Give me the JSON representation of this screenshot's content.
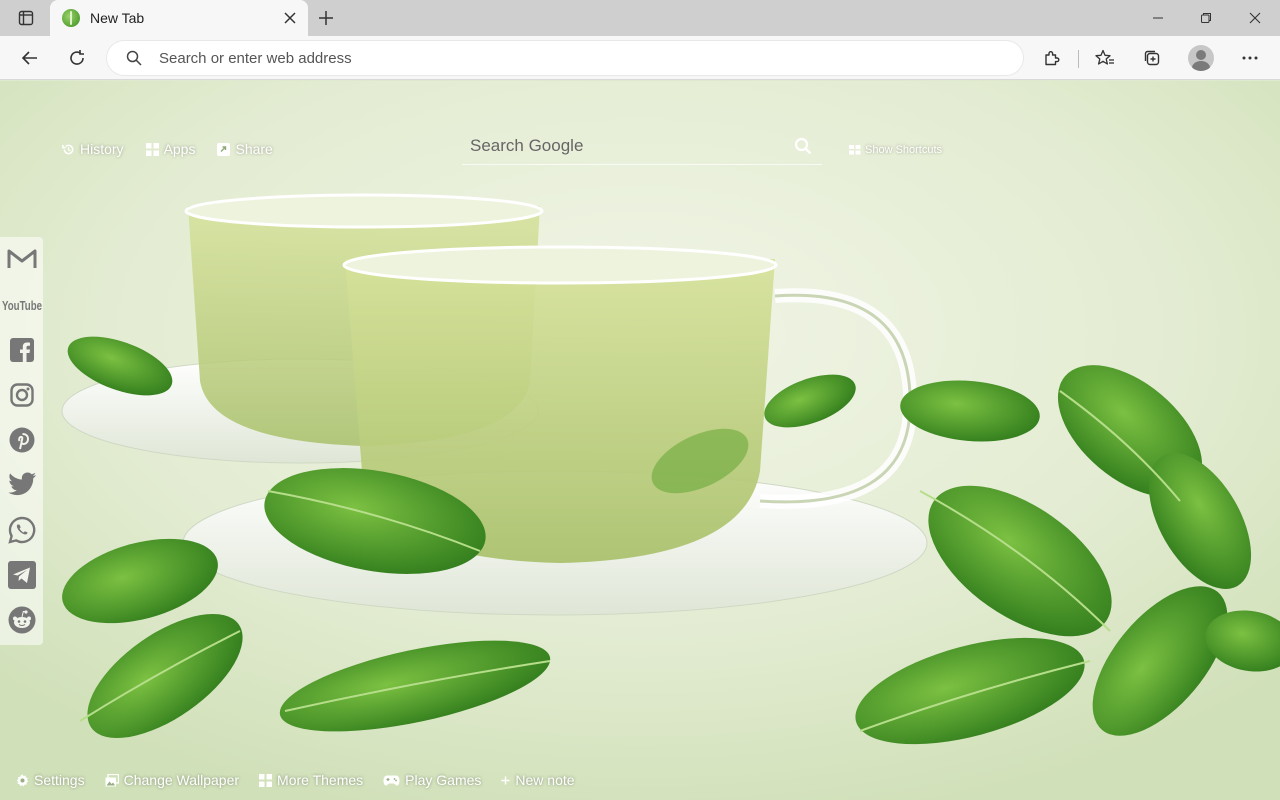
{
  "browser": {
    "tab": {
      "title": "New Tab"
    },
    "address_bar": {
      "placeholder": "Search or enter web address"
    }
  },
  "ntp": {
    "top_nav": [
      {
        "label": "History",
        "icon": "history-icon"
      },
      {
        "label": "Apps",
        "icon": "apps-grid-icon"
      },
      {
        "label": "Share",
        "icon": "share-icon"
      }
    ],
    "search": {
      "placeholder": "Search Google"
    },
    "shortcuts_label": "Show Shortcuts",
    "social_links": [
      {
        "name": "gmail",
        "icon": "gmail-icon"
      },
      {
        "name": "youtube",
        "icon": "youtube-icon"
      },
      {
        "name": "facebook",
        "icon": "facebook-icon"
      },
      {
        "name": "instagram",
        "icon": "instagram-icon"
      },
      {
        "name": "pinterest",
        "icon": "pinterest-icon"
      },
      {
        "name": "twitter",
        "icon": "twitter-icon"
      },
      {
        "name": "whatsapp",
        "icon": "whatsapp-icon"
      },
      {
        "name": "telegram",
        "icon": "telegram-icon"
      },
      {
        "name": "reddit",
        "icon": "reddit-icon"
      }
    ],
    "youtube_wordmark": "YouTube",
    "bottom_bar": [
      {
        "label": "Settings",
        "icon": "gear-icon"
      },
      {
        "label": "Change Wallpaper",
        "icon": "wallpaper-icon"
      },
      {
        "label": "More Themes",
        "icon": "themes-grid-icon"
      },
      {
        "label": "Play Games",
        "icon": "gamepad-icon"
      },
      {
        "label": "New note",
        "icon": "plus-icon"
      }
    ]
  },
  "colors": {
    "leaf_dark": "#2f7a1c",
    "leaf_light": "#6fb43a",
    "tea": "#c9d98a",
    "background": "#e3ecd2"
  }
}
